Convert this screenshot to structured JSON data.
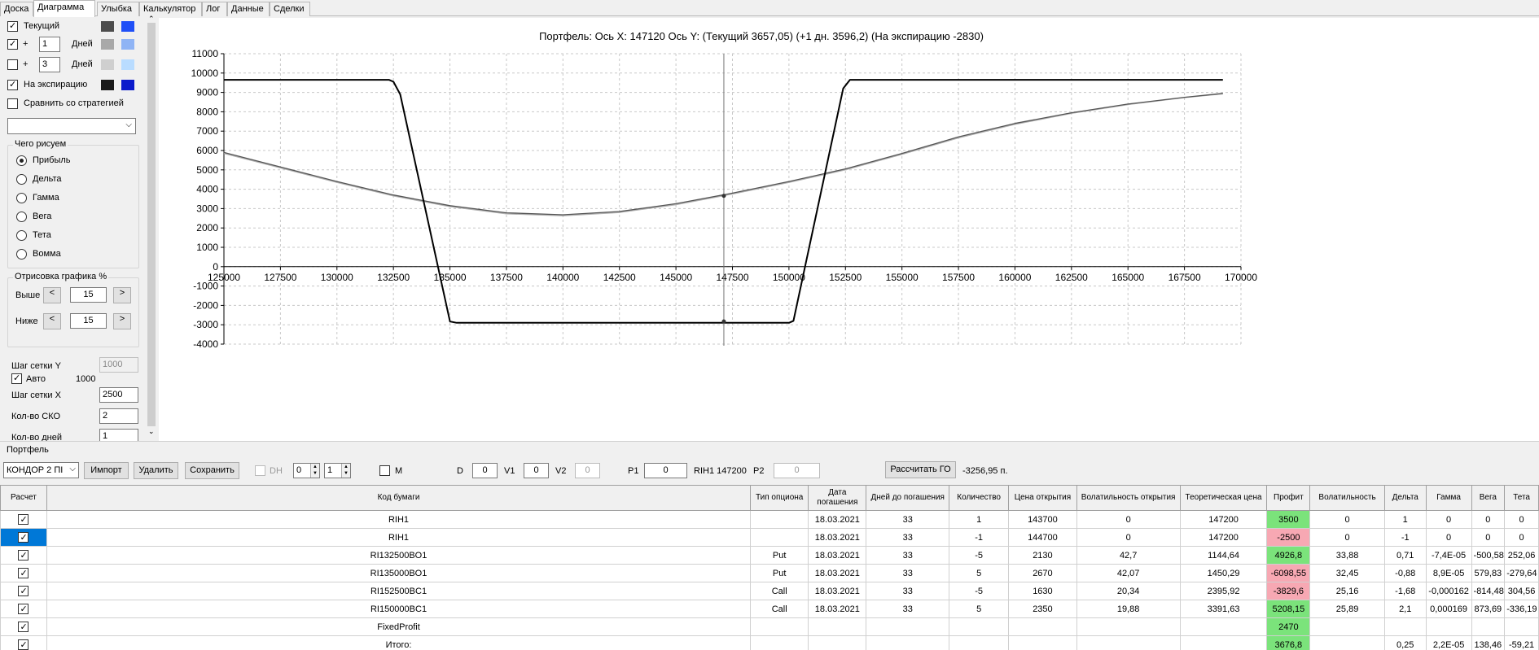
{
  "tabs": [
    "Доска",
    "Диаграмма",
    "Улыбка",
    "Калькулятор",
    "Лог",
    "Данные",
    "Сделки"
  ],
  "active_tab": "Диаграмма",
  "left_panel": {
    "current": {
      "label": "Текущий",
      "checked": true
    },
    "plus1": {
      "plus": "+",
      "value": "1",
      "unit": "Дней",
      "checked": true
    },
    "plus3": {
      "plus": "+",
      "value": "3",
      "unit": "Дней",
      "checked": false
    },
    "expiry": {
      "label": "На экспирацию",
      "checked": true
    },
    "compare": {
      "label": "Сравнить со стратегией",
      "checked": false
    },
    "what_group_title": "Чего рисуем",
    "what_options": [
      "Прибыль",
      "Дельта",
      "Гамма",
      "Вега",
      "Тета",
      "Вомма"
    ],
    "what_selected": "Прибыль",
    "draw_group_title": "Отрисовка графика %",
    "above_label": "Выше",
    "above_value": "15",
    "below_label": "Ниже",
    "below_value": "15",
    "btn_left": "<",
    "btn_right": ">",
    "grid_y_label": "Шаг сетки Y",
    "grid_y_value": "1000",
    "auto_label": "Авто",
    "auto_value": "1000",
    "grid_x_label": "Шаг сетки X",
    "grid_x_value": "2500",
    "sko_label": "Кол-во СКО",
    "sko_value": "2",
    "days_label": "Кол-во дней",
    "days_value": "1",
    "colors": {
      "current": [
        "#4d4d4d",
        "#1f4ff7"
      ],
      "plus1": [
        "#a9a9a9",
        "#8fb4f5"
      ],
      "plus3": [
        "#cfcfcf",
        "#b9dcff"
      ],
      "expiry": [
        "#1a1a1a",
        "#0a1acb"
      ]
    }
  },
  "chart_title": "Портфель: Ось X: 147120 Ось Y:  (Текущий 3657,05)  (+1 дн. 3596,2)  (На экспирацию -2830)",
  "chart_data": {
    "type": "line",
    "xlim": [
      125000,
      170000
    ],
    "ylim": [
      -4000,
      11000
    ],
    "x_ticks": [
      125000,
      127500,
      130000,
      132500,
      135000,
      137500,
      140000,
      142500,
      145000,
      147500,
      150000,
      152500,
      155000,
      157500,
      160000,
      162500,
      165000,
      167500,
      170000
    ],
    "y_ticks": [
      -4000,
      -3000,
      -2000,
      -1000,
      0,
      1000,
      2000,
      3000,
      4000,
      5000,
      6000,
      7000,
      8000,
      9000,
      10000,
      11000
    ],
    "cursor_x": 147120,
    "series": [
      {
        "name": "На экспирацию",
        "color": "#000000",
        "x": [
          125000,
          132300,
          132500,
          132800,
          135000,
          135300,
          150000,
          150200,
          152400,
          152700,
          153000,
          169200
        ],
        "y": [
          9650,
          9650,
          9550,
          8900,
          -2830,
          -2900,
          -2900,
          -2800,
          9200,
          9650,
          9650,
          9650
        ]
      },
      {
        "name": "Текущий",
        "color": "#555555",
        "x": [
          125000,
          127500,
          130000,
          132500,
          135000,
          137500,
          140000,
          142500,
          145000,
          147500,
          150000,
          152500,
          155000,
          157500,
          160000,
          162500,
          165000,
          167500,
          169200
        ],
        "y": [
          5900,
          5150,
          4400,
          3700,
          3150,
          2780,
          2680,
          2850,
          3250,
          3800,
          4400,
          5050,
          5850,
          6700,
          7400,
          7950,
          8400,
          8750,
          8950
        ]
      },
      {
        "name": "+1 дн.",
        "color": "#b0b0b0",
        "x": [
          125000,
          127500,
          130000,
          132500,
          135000,
          137500,
          140000,
          142500,
          145000,
          147500,
          150000,
          152500,
          155000,
          157500,
          160000,
          162500,
          165000,
          167500,
          169200
        ],
        "y": [
          5850,
          5100,
          4350,
          3650,
          3100,
          2730,
          2630,
          2800,
          3200,
          3750,
          4350,
          5000,
          5800,
          6650,
          7350,
          7920,
          8370,
          8730,
          8930
        ]
      }
    ],
    "markers": [
      {
        "x": 147120,
        "y": 3657
      },
      {
        "x": 147120,
        "y": -2830
      }
    ]
  },
  "portfolio": {
    "title": "Портфель",
    "select_value": "КОНДОР 2 ПI",
    "import_btn": "Импорт",
    "delete_btn": "Удалить",
    "save_btn": "Сохранить",
    "dh_label": "DH",
    "spin1": "0",
    "spin2": "1",
    "m_label": "M",
    "d_label": "D",
    "d_value": "0",
    "v1_label": "V1",
    "v1_value": "0",
    "v2_label": "V2",
    "v2_value": "0",
    "p1_label": "P1",
    "p1_value": "0",
    "rih_label": "RIH1 147200",
    "p2_label": "P2",
    "p2_value": "0",
    "calc_btn": "Рассчитать ГО",
    "go_value": "-3256,95 п."
  },
  "table": {
    "headers": [
      "Расчет",
      "Код бумаги",
      "Тип опциона",
      "Дата погашения",
      "Дней до погашения",
      "Количество",
      "Цена открытия",
      "Волатильность открытия",
      "Теоретическая цена",
      "Профит",
      "Волатильность",
      "Дельта",
      "Гамма",
      "Вега",
      "Тета"
    ],
    "rows": [
      [
        "RIH1",
        "",
        "18.03.2021",
        "33",
        "1",
        "143700",
        "0",
        "147200",
        "3500",
        "0",
        "1",
        "0",
        "0",
        "0"
      ],
      [
        "RIH1",
        "",
        "18.03.2021",
        "33",
        "-1",
        "144700",
        "0",
        "147200",
        "-2500",
        "0",
        "-1",
        "0",
        "0",
        "0"
      ],
      [
        "RI132500BO1",
        "Put",
        "18.03.2021",
        "33",
        "-5",
        "2130",
        "42,7",
        "1144,64",
        "4926,8",
        "33,88",
        "0,71",
        "-7,4E-05",
        "-500,58",
        "252,06"
      ],
      [
        "RI135000BO1",
        "Put",
        "18.03.2021",
        "33",
        "5",
        "2670",
        "42,07",
        "1450,29",
        "-6098,55",
        "32,45",
        "-0,88",
        "8,9E-05",
        "579,83",
        "-279,64"
      ],
      [
        "RI152500BC1",
        "Call",
        "18.03.2021",
        "33",
        "-5",
        "1630",
        "20,34",
        "2395,92",
        "-3829,6",
        "25,16",
        "-1,68",
        "-0,000162",
        "-814,48",
        "304,56"
      ],
      [
        "RI150000BC1",
        "Call",
        "18.03.2021",
        "33",
        "5",
        "2350",
        "19,88",
        "3391,63",
        "5208,15",
        "25,89",
        "2,1",
        "0,000169",
        "873,69",
        "-336,19"
      ],
      [
        "FixedProfit",
        "",
        "",
        "",
        "",
        "",
        "",
        "",
        "2470",
        "",
        "",
        "",
        "",
        ""
      ],
      [
        "Итого:",
        "",
        "",
        "",
        "",
        "",
        "",
        "",
        "3676,8",
        "",
        "0,25",
        "2,2E-05",
        "138,46",
        "-59,21"
      ]
    ]
  }
}
